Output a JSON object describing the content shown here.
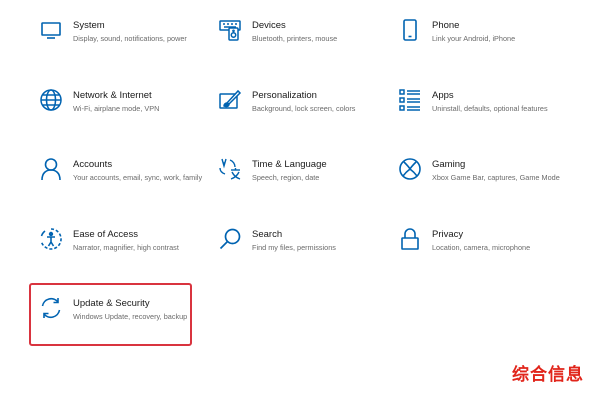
{
  "accent_color": "#0063b1",
  "highlight_color": "#d9343f",
  "tiles": [
    {
      "title": "System",
      "desc": "Display, sound, notifications, power",
      "icon": "monitor-icon"
    },
    {
      "title": "Devices",
      "desc": "Bluetooth, printers, mouse",
      "icon": "keyboard-speaker-icon"
    },
    {
      "title": "Phone",
      "desc": "Link your Android, iPhone",
      "icon": "phone-icon"
    },
    {
      "title": "Network & Internet",
      "desc": "Wi-Fi, airplane mode, VPN",
      "icon": "globe-icon"
    },
    {
      "title": "Personalization",
      "desc": "Background, lock screen, colors",
      "icon": "paint-brush-icon"
    },
    {
      "title": "Apps",
      "desc": "Uninstall, defaults, optional features",
      "icon": "apps-list-icon"
    },
    {
      "title": "Accounts",
      "desc": "Your accounts, email, sync, work, family",
      "icon": "person-icon"
    },
    {
      "title": "Time & Language",
      "desc": "Speech, region, date",
      "icon": "time-language-icon"
    },
    {
      "title": "Gaming",
      "desc": "Xbox Game Bar, captures, Game Mode",
      "icon": "xbox-icon"
    },
    {
      "title": "Ease of Access",
      "desc": "Narrator, magnifier, high contrast",
      "icon": "ease-of-access-icon"
    },
    {
      "title": "Search",
      "desc": "Find my files, permissions",
      "icon": "search-icon"
    },
    {
      "title": "Privacy",
      "desc": "Location, camera, microphone",
      "icon": "lock-icon"
    },
    {
      "title": "Update & Security",
      "desc": "Windows Update, recovery, backup",
      "icon": "sync-icon"
    }
  ],
  "watermark": "综合信息"
}
